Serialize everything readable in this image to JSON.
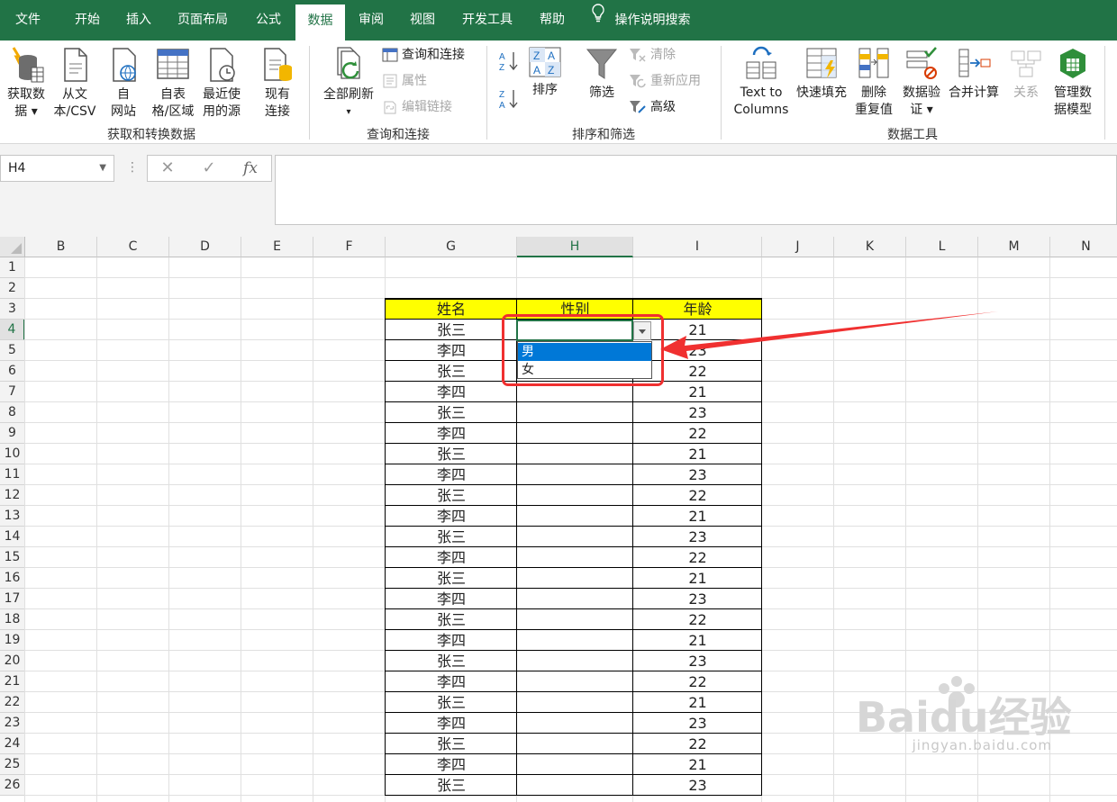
{
  "ribbon_tabs": [
    {
      "label": "文件"
    },
    {
      "label": "开始"
    },
    {
      "label": "插入"
    },
    {
      "label": "页面布局"
    },
    {
      "label": "公式"
    },
    {
      "label": "数据"
    },
    {
      "label": "审阅"
    },
    {
      "label": "视图"
    },
    {
      "label": "开发工具"
    },
    {
      "label": "帮助"
    }
  ],
  "active_tab": "数据",
  "tell_me": "操作说明搜索",
  "groups": {
    "get_transform": {
      "label": "获取和转换数据",
      "buttons": [
        {
          "line1": "获取数",
          "line2": "据 ▾"
        },
        {
          "line1": "从文",
          "line2": "本/CSV"
        },
        {
          "line1": "自",
          "line2": "网站"
        },
        {
          "line1": "自表",
          "line2": "格/区域"
        },
        {
          "line1": "最近使",
          "line2": "用的源"
        },
        {
          "line1": "现有",
          "line2": "连接"
        }
      ]
    },
    "queries": {
      "label": "查询和连接",
      "refresh_line1": "全部刷新",
      "refresh_line2": "▾",
      "small": [
        "查询和连接",
        "属性",
        "编辑链接"
      ]
    },
    "sort_filter": {
      "label": "排序和筛选",
      "sort": "排序",
      "filter": "筛选",
      "small": [
        "清除",
        "重新应用",
        "高级"
      ]
    },
    "data_tools": {
      "label": "数据工具",
      "buttons": [
        {
          "line1": "Text to",
          "line2": "Columns"
        },
        {
          "line1": "快速填充",
          "line2": ""
        },
        {
          "line1": "删除",
          "line2": "重复值"
        },
        {
          "line1": "数据验",
          "line2": "证 ▾"
        },
        {
          "line1": "合并计算",
          "line2": ""
        },
        {
          "line1": "关系",
          "line2": ""
        },
        {
          "line1": "管理数",
          "line2": "据模型"
        }
      ]
    }
  },
  "formula_bar": {
    "name_box": "H4",
    "cancel": "✕",
    "enter": "✓",
    "fx": "fx",
    "value": ""
  },
  "columns": [
    "B",
    "C",
    "D",
    "E",
    "F",
    "G",
    "H",
    "I",
    "J",
    "K",
    "L",
    "M",
    "N"
  ],
  "rows": [
    "1",
    "2",
    "3",
    "4",
    "5",
    "6",
    "7",
    "8",
    "9",
    "10",
    "11",
    "12",
    "13",
    "14",
    "15",
    "16",
    "17",
    "18",
    "19",
    "20",
    "21",
    "22",
    "23",
    "24",
    "25",
    "26"
  ],
  "table": {
    "headers": [
      "姓名",
      "性别",
      "年龄"
    ],
    "rows": [
      [
        "张三",
        "",
        "21"
      ],
      [
        "李四",
        "",
        "23"
      ],
      [
        "张三",
        "",
        "22"
      ],
      [
        "李四",
        "",
        "21"
      ],
      [
        "张三",
        "",
        "23"
      ],
      [
        "李四",
        "",
        "22"
      ],
      [
        "张三",
        "",
        "21"
      ],
      [
        "李四",
        "",
        "23"
      ],
      [
        "张三",
        "",
        "22"
      ],
      [
        "李四",
        "",
        "21"
      ],
      [
        "张三",
        "",
        "23"
      ],
      [
        "李四",
        "",
        "22"
      ],
      [
        "张三",
        "",
        "21"
      ],
      [
        "李四",
        "",
        "23"
      ],
      [
        "张三",
        "",
        "22"
      ],
      [
        "李四",
        "",
        "21"
      ],
      [
        "张三",
        "",
        "23"
      ],
      [
        "李四",
        "",
        "22"
      ],
      [
        "张三",
        "",
        "21"
      ],
      [
        "李四",
        "",
        "23"
      ],
      [
        "张三",
        "",
        "22"
      ],
      [
        "李四",
        "",
        "21"
      ],
      [
        "张三",
        "",
        "23"
      ]
    ]
  },
  "dropdown": {
    "options": [
      "男",
      "女"
    ],
    "highlighted": 0
  },
  "watermark": {
    "logo": "Baidu经验",
    "url": "jingyan.baidu.com"
  },
  "colors": {
    "excel_green": "#217346",
    "header_yellow": "#ffff00",
    "highlight_blue": "#0078d7",
    "annotation_red": "#f03030"
  }
}
